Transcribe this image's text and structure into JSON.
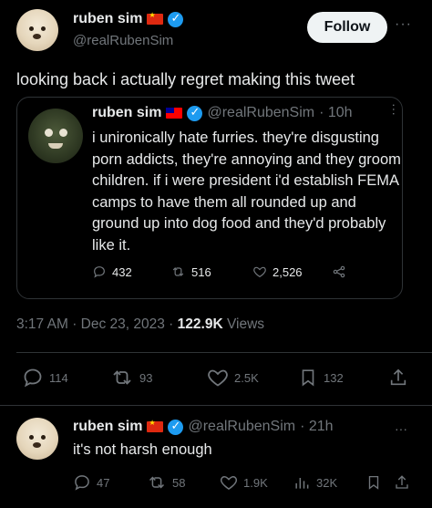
{
  "main_tweet": {
    "author": {
      "name": "ruben sim",
      "handle": "@realRubenSim"
    },
    "follow_label": "Follow",
    "text": "looking back i actually regret making this tweet",
    "quoted": {
      "author": {
        "name": "ruben sim",
        "handle": "@realRubenSim",
        "time": "· 10h"
      },
      "text": "i unironically hate furries. they're disgusting porn addicts, they're annoying and they groom children. if i were president i'd establish FEMA camps to have them all rounded up and ground up into dog food and they'd probably like it.",
      "stats": {
        "replies": "432",
        "retweets": "516",
        "likes": "2,526"
      }
    },
    "meta": {
      "time": "3:17 AM",
      "date": "· Dec 23, 2023 ·",
      "views_count": "122.9K",
      "views_label": "Views"
    },
    "stats": {
      "replies": "114",
      "retweets": "93",
      "likes": "2.5K",
      "bookmarks": "132"
    }
  },
  "reply": {
    "author": {
      "name": "ruben sim",
      "handle": "@realRubenSim",
      "time": "· 21h"
    },
    "text": "it's not harsh enough",
    "stats": {
      "replies": "47",
      "retweets": "58",
      "likes": "1.9K",
      "views": "32K"
    }
  }
}
